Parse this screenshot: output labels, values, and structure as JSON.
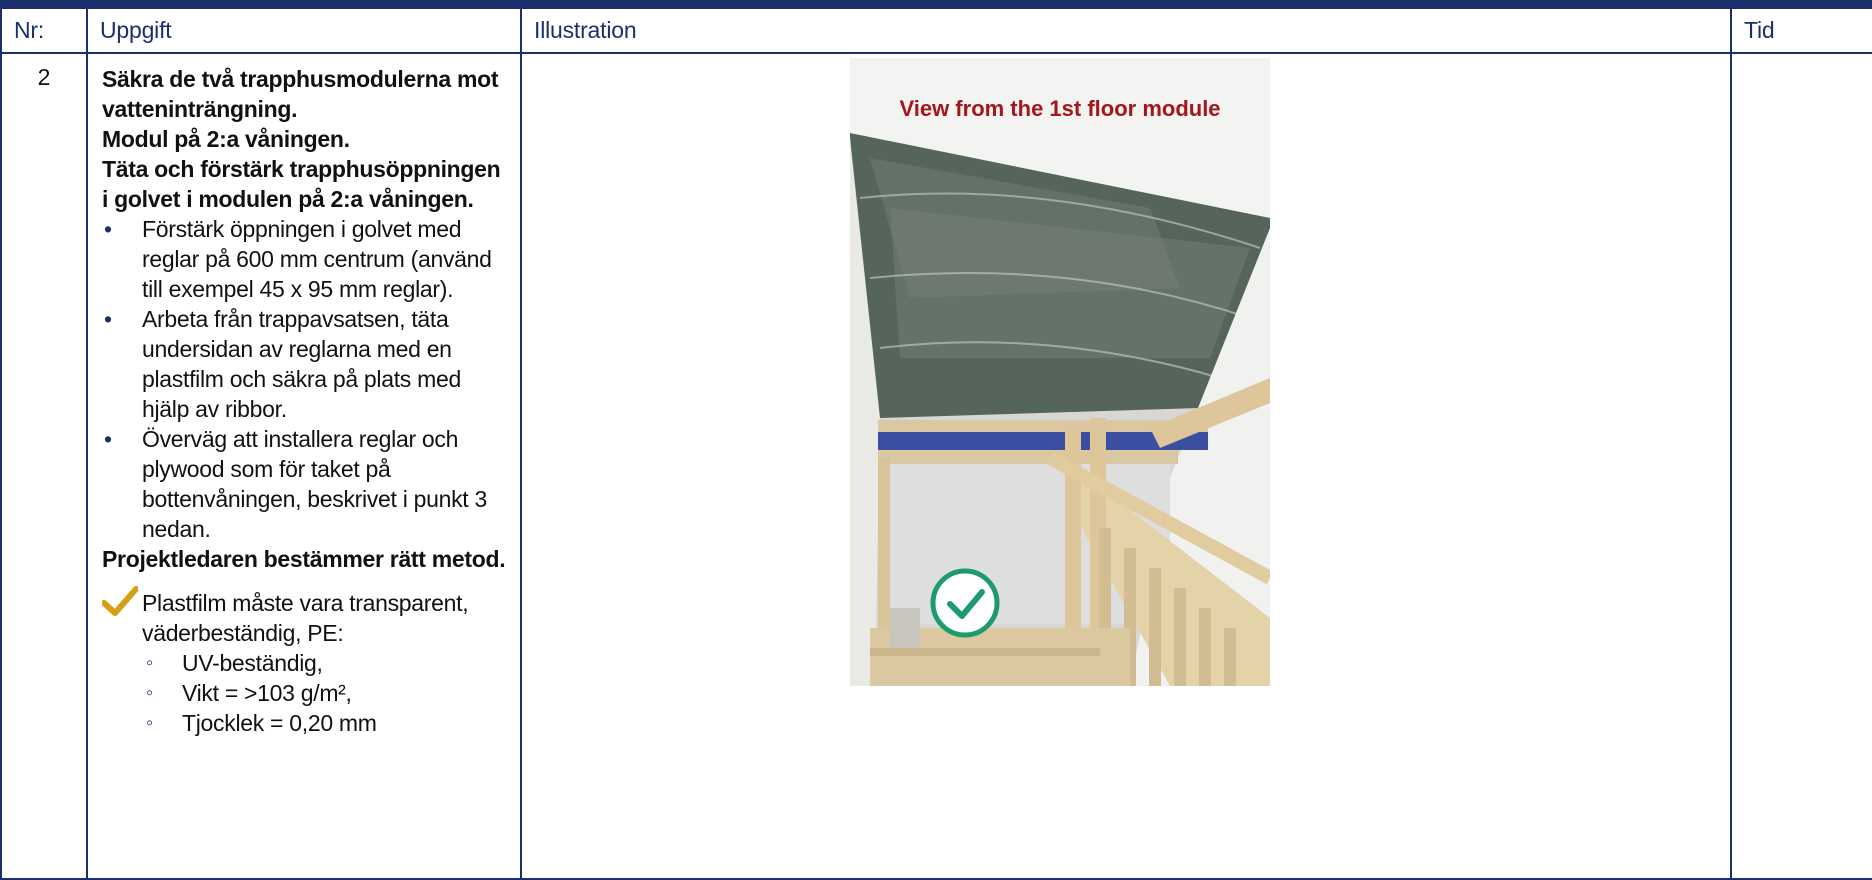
{
  "table": {
    "headers": {
      "nr": "Nr:",
      "task": "Uppgift",
      "illustration": "Illustration",
      "time": "Tid"
    },
    "row": {
      "nr": "2",
      "heading_1": "Säkra de två trapphusmodulerna mot vatteninträngning.",
      "heading_2": "Modul på 2:a våningen.",
      "heading_3": "Täta och förstärk trapphusöppningen i golvet i modulen på 2:a våningen.",
      "bullets": [
        "Förstärk öppningen i golvet med reglar på 600 mm centrum (använd till exempel 45 x 95 mm reglar).",
        "Arbeta från trappavsatsen, täta undersidan av reglarna med en plastfilm och säkra på plats med hjälp av ribbor.",
        "Överväg att installera reglar och plywood som för taket på bottenvåningen, beskrivet i punkt 3 nedan."
      ],
      "conclusion": "Projektledaren bestämmer rätt metod.",
      "note": "Plastfilm måste vara transparent, väderbeständig, PE:",
      "sub_items": [
        "UV-beständig,",
        "Vikt = >103 g/m²,",
        "Tjocklek = 0,20 mm"
      ],
      "photo_caption": "View from the 1st floor module",
      "time": ""
    }
  },
  "colors": {
    "border": "#1b2f6b",
    "header_text": "#1b2f6b",
    "check": "#d4a017",
    "caption": "#a3161c",
    "approval": "#1e9b6b"
  },
  "icons": {
    "note_icon": "checkmark-icon",
    "approval_icon": "check-circle-icon"
  }
}
